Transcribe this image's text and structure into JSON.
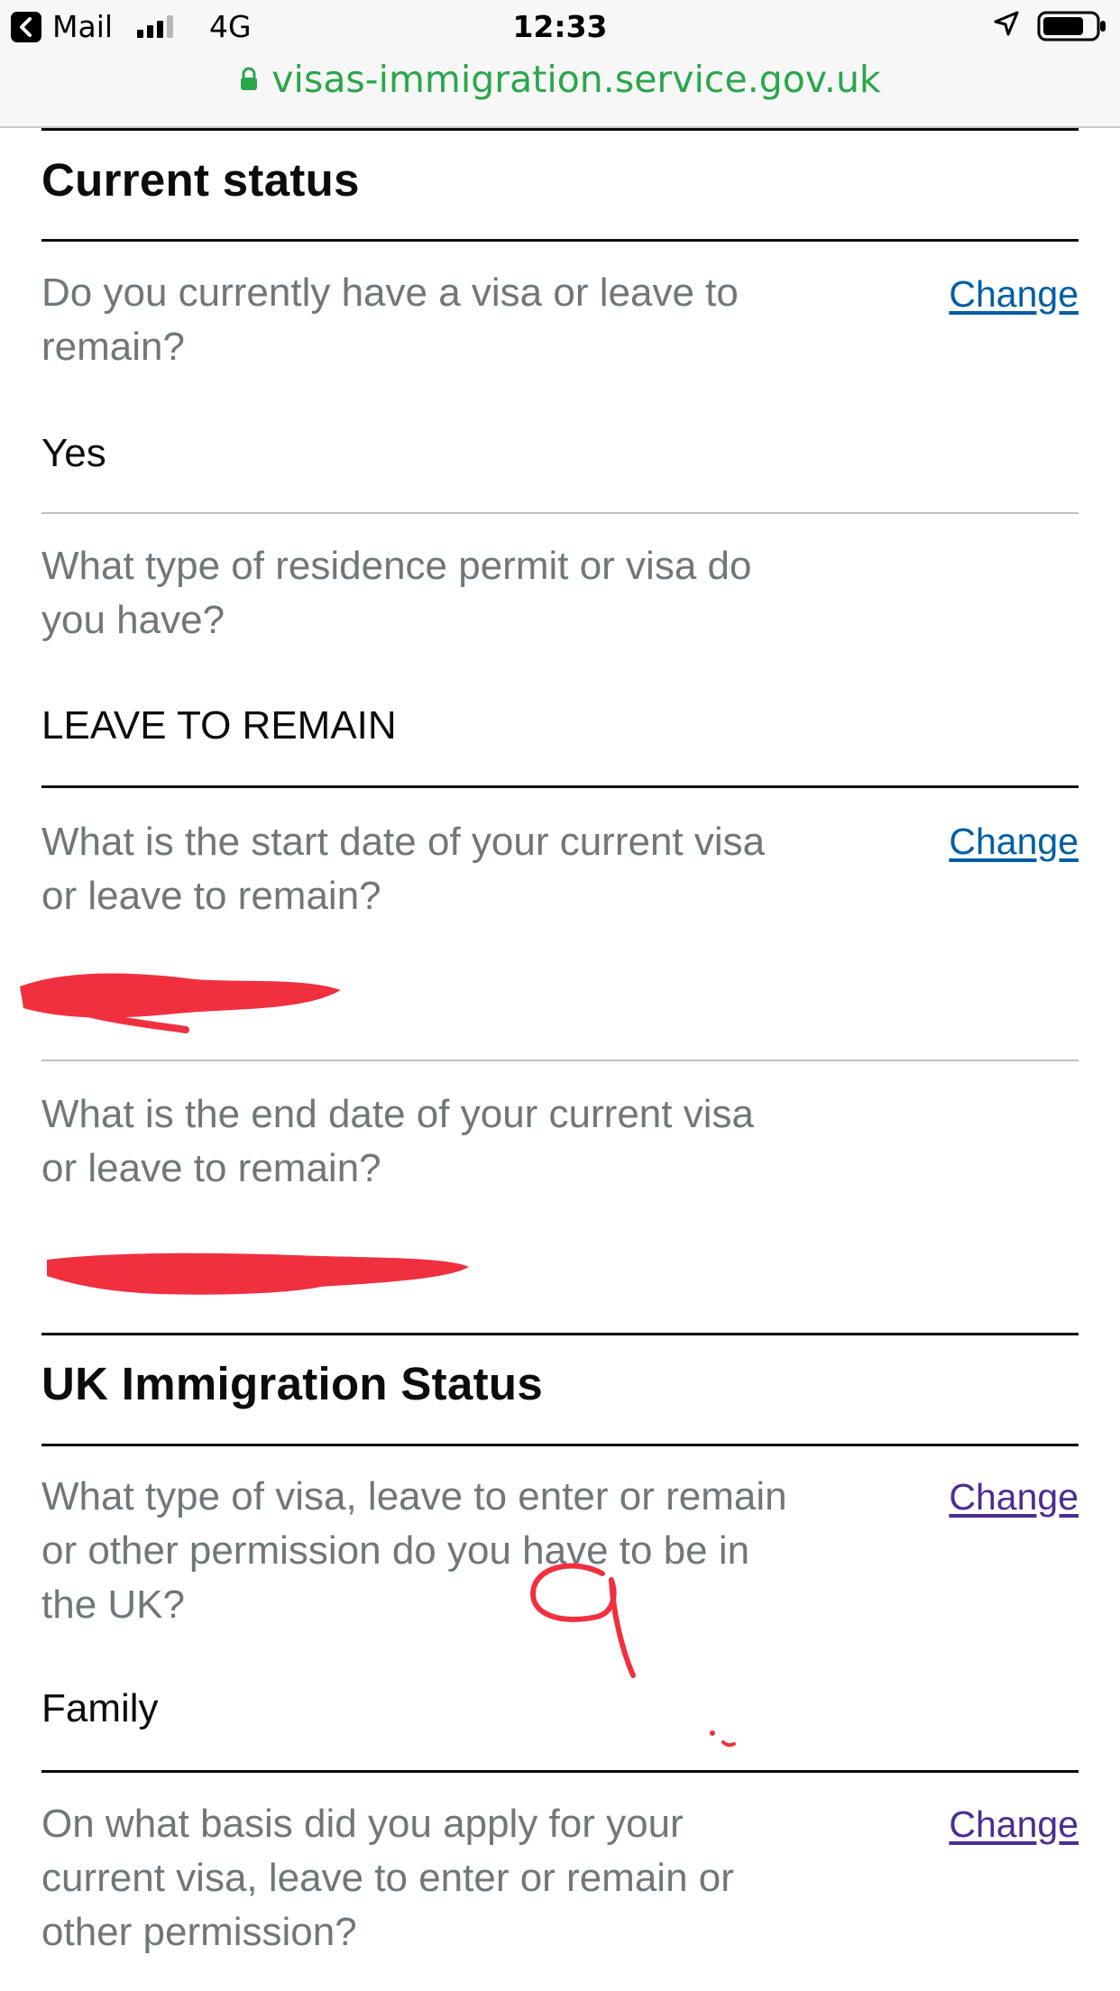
{
  "status_bar": {
    "back_app": "Mail",
    "network": "4G",
    "time": "12:33",
    "url": "visas-immigration.service.gov.uk"
  },
  "sections": [
    {
      "heading": "Current status",
      "rows": [
        {
          "question": "Do you currently have a visa or leave to remain?",
          "answer": "Yes",
          "change": "Change"
        },
        {
          "question": "What type of residence permit or visa do you have?",
          "answer": "LEAVE TO REMAIN"
        },
        {
          "question": "What is the start date of your current visa or leave to remain?",
          "answer": "[redacted]",
          "change": "Change"
        },
        {
          "question": "What is the end date of your current visa or leave to remain?",
          "answer": "[redacted]"
        }
      ]
    },
    {
      "heading": "UK Immigration Status",
      "rows": [
        {
          "question": "What type of visa, leave to enter or remain or other permission do you have to be in the UK?",
          "answer": "Family",
          "change": "Change"
        },
        {
          "question": "On what basis did you apply for your current visa, leave to enter or remain or other permission?",
          "change": "Change"
        }
      ]
    }
  ],
  "colors": {
    "question_text": "#6f777b",
    "link_blue": "#005ea5",
    "link_visited": "#4c2c92",
    "url_green": "#29a74a",
    "redaction_red": "#f0303f"
  },
  "icons": [
    "back-arrow-icon",
    "signal-bars-icon",
    "location-arrow-icon",
    "battery-icon",
    "padlock-icon"
  ]
}
